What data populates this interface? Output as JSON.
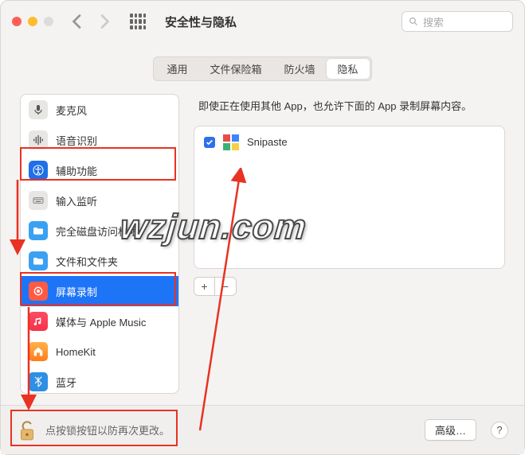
{
  "window": {
    "title": "安全性与隐私"
  },
  "search": {
    "placeholder": "搜索"
  },
  "tabs": [
    {
      "label": "通用"
    },
    {
      "label": "文件保险箱"
    },
    {
      "label": "防火墙"
    },
    {
      "label": "隐私",
      "active": true
    }
  ],
  "sidebar": {
    "items": [
      {
        "label": "麦克风",
        "name": "microphone"
      },
      {
        "label": "语音识别",
        "name": "speech-recognition"
      },
      {
        "label": "辅助功能",
        "name": "accessibility"
      },
      {
        "label": "输入监听",
        "name": "input-monitoring"
      },
      {
        "label": "完全磁盘访问权限",
        "name": "full-disk-access"
      },
      {
        "label": "文件和文件夹",
        "name": "files-and-folders"
      },
      {
        "label": "屏幕录制",
        "name": "screen-recording",
        "selected": true
      },
      {
        "label": "媒体与 Apple Music",
        "name": "media-apple-music"
      },
      {
        "label": "HomeKit",
        "name": "homekit"
      },
      {
        "label": "蓝牙",
        "name": "bluetooth"
      }
    ]
  },
  "right": {
    "description": "即使正在使用其他 App，也允许下面的 App 录制屏幕内容。",
    "apps": [
      {
        "name": "Snipaste",
        "checked": true
      }
    ],
    "add": "+",
    "remove": "−"
  },
  "footer": {
    "lock_text": "点按锁按钮以防再次更改。",
    "advanced": "高级…",
    "help": "?"
  },
  "watermark": "wzjun.com"
}
